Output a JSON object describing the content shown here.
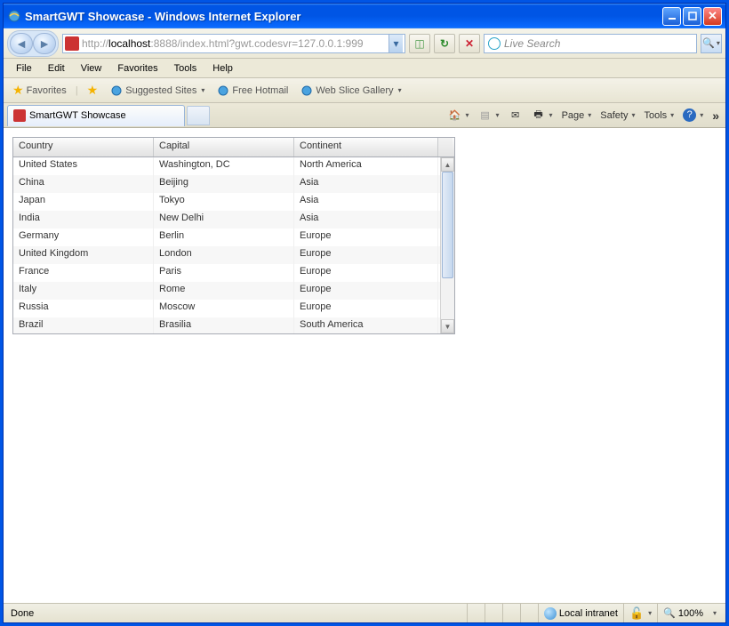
{
  "window": {
    "title": "SmartGWT Showcase - Windows Internet Explorer"
  },
  "address": {
    "prefix": "http://",
    "host": "localhost",
    "rest": ":8888/index.html?gwt.codesvr=127.0.0.1:999"
  },
  "search": {
    "placeholder": "Live Search"
  },
  "menu": {
    "file": "File",
    "edit": "Edit",
    "view": "View",
    "favorites": "Favorites",
    "tools": "Tools",
    "help": "Help"
  },
  "favbar": {
    "favorites": "Favorites",
    "suggested": "Suggested Sites",
    "hotmail": "Free Hotmail",
    "webslice": "Web Slice Gallery"
  },
  "tab": {
    "label": "SmartGWT Showcase"
  },
  "cmd": {
    "page": "Page",
    "safety": "Safety",
    "tools": "Tools"
  },
  "grid": {
    "headers": {
      "country": "Country",
      "capital": "Capital",
      "continent": "Continent"
    },
    "rows": [
      {
        "country": "United States",
        "capital": "Washington, DC",
        "continent": "North America"
      },
      {
        "country": "China",
        "capital": "Beijing",
        "continent": "Asia"
      },
      {
        "country": "Japan",
        "capital": "Tokyo",
        "continent": "Asia"
      },
      {
        "country": "India",
        "capital": "New Delhi",
        "continent": "Asia"
      },
      {
        "country": "Germany",
        "capital": "Berlin",
        "continent": "Europe"
      },
      {
        "country": "United Kingdom",
        "capital": "London",
        "continent": "Europe"
      },
      {
        "country": "France",
        "capital": "Paris",
        "continent": "Europe"
      },
      {
        "country": "Italy",
        "capital": "Rome",
        "continent": "Europe"
      },
      {
        "country": "Russia",
        "capital": "Moscow",
        "continent": "Europe"
      },
      {
        "country": "Brazil",
        "capital": "Brasilia",
        "continent": "South America"
      }
    ]
  },
  "status": {
    "done": "Done",
    "zone": "Local intranet",
    "zoom": "100%"
  }
}
